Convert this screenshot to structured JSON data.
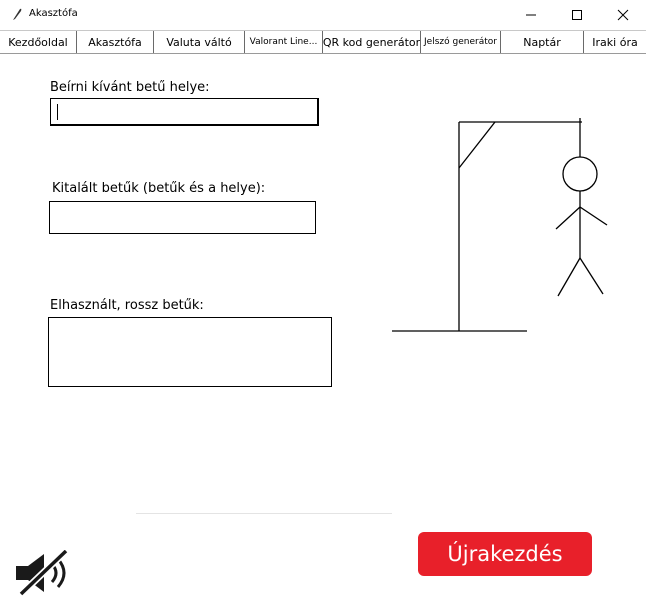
{
  "window": {
    "title": "Akasztófa",
    "min_icon": "minimize-icon",
    "max_icon": "maximize-icon",
    "close_icon": "close-icon"
  },
  "tabs": [
    {
      "label": "Kezdőoldal"
    },
    {
      "label": "Akasztófa"
    },
    {
      "label": "Valuta váltó"
    },
    {
      "label": "Valorant Line..."
    },
    {
      "label": "QR kod generátor"
    },
    {
      "label": "Jelszó generátor"
    },
    {
      "label": "Naptár"
    },
    {
      "label": "Iraki óra"
    }
  ],
  "form": {
    "position_label": "Beírni kívánt betű helye:",
    "position_value": "",
    "found_label": "Kitalált betűk (betűk és a helye):",
    "found_value": "",
    "wrong_label": "Elhasznált, rossz betűk:",
    "wrong_value": ""
  },
  "restart_label": "Újrakezdés",
  "colors": {
    "restart_bg": "#e8202a"
  },
  "icons": {
    "sound": "mute-speaker-icon",
    "drawing": "hangman-gallows"
  }
}
